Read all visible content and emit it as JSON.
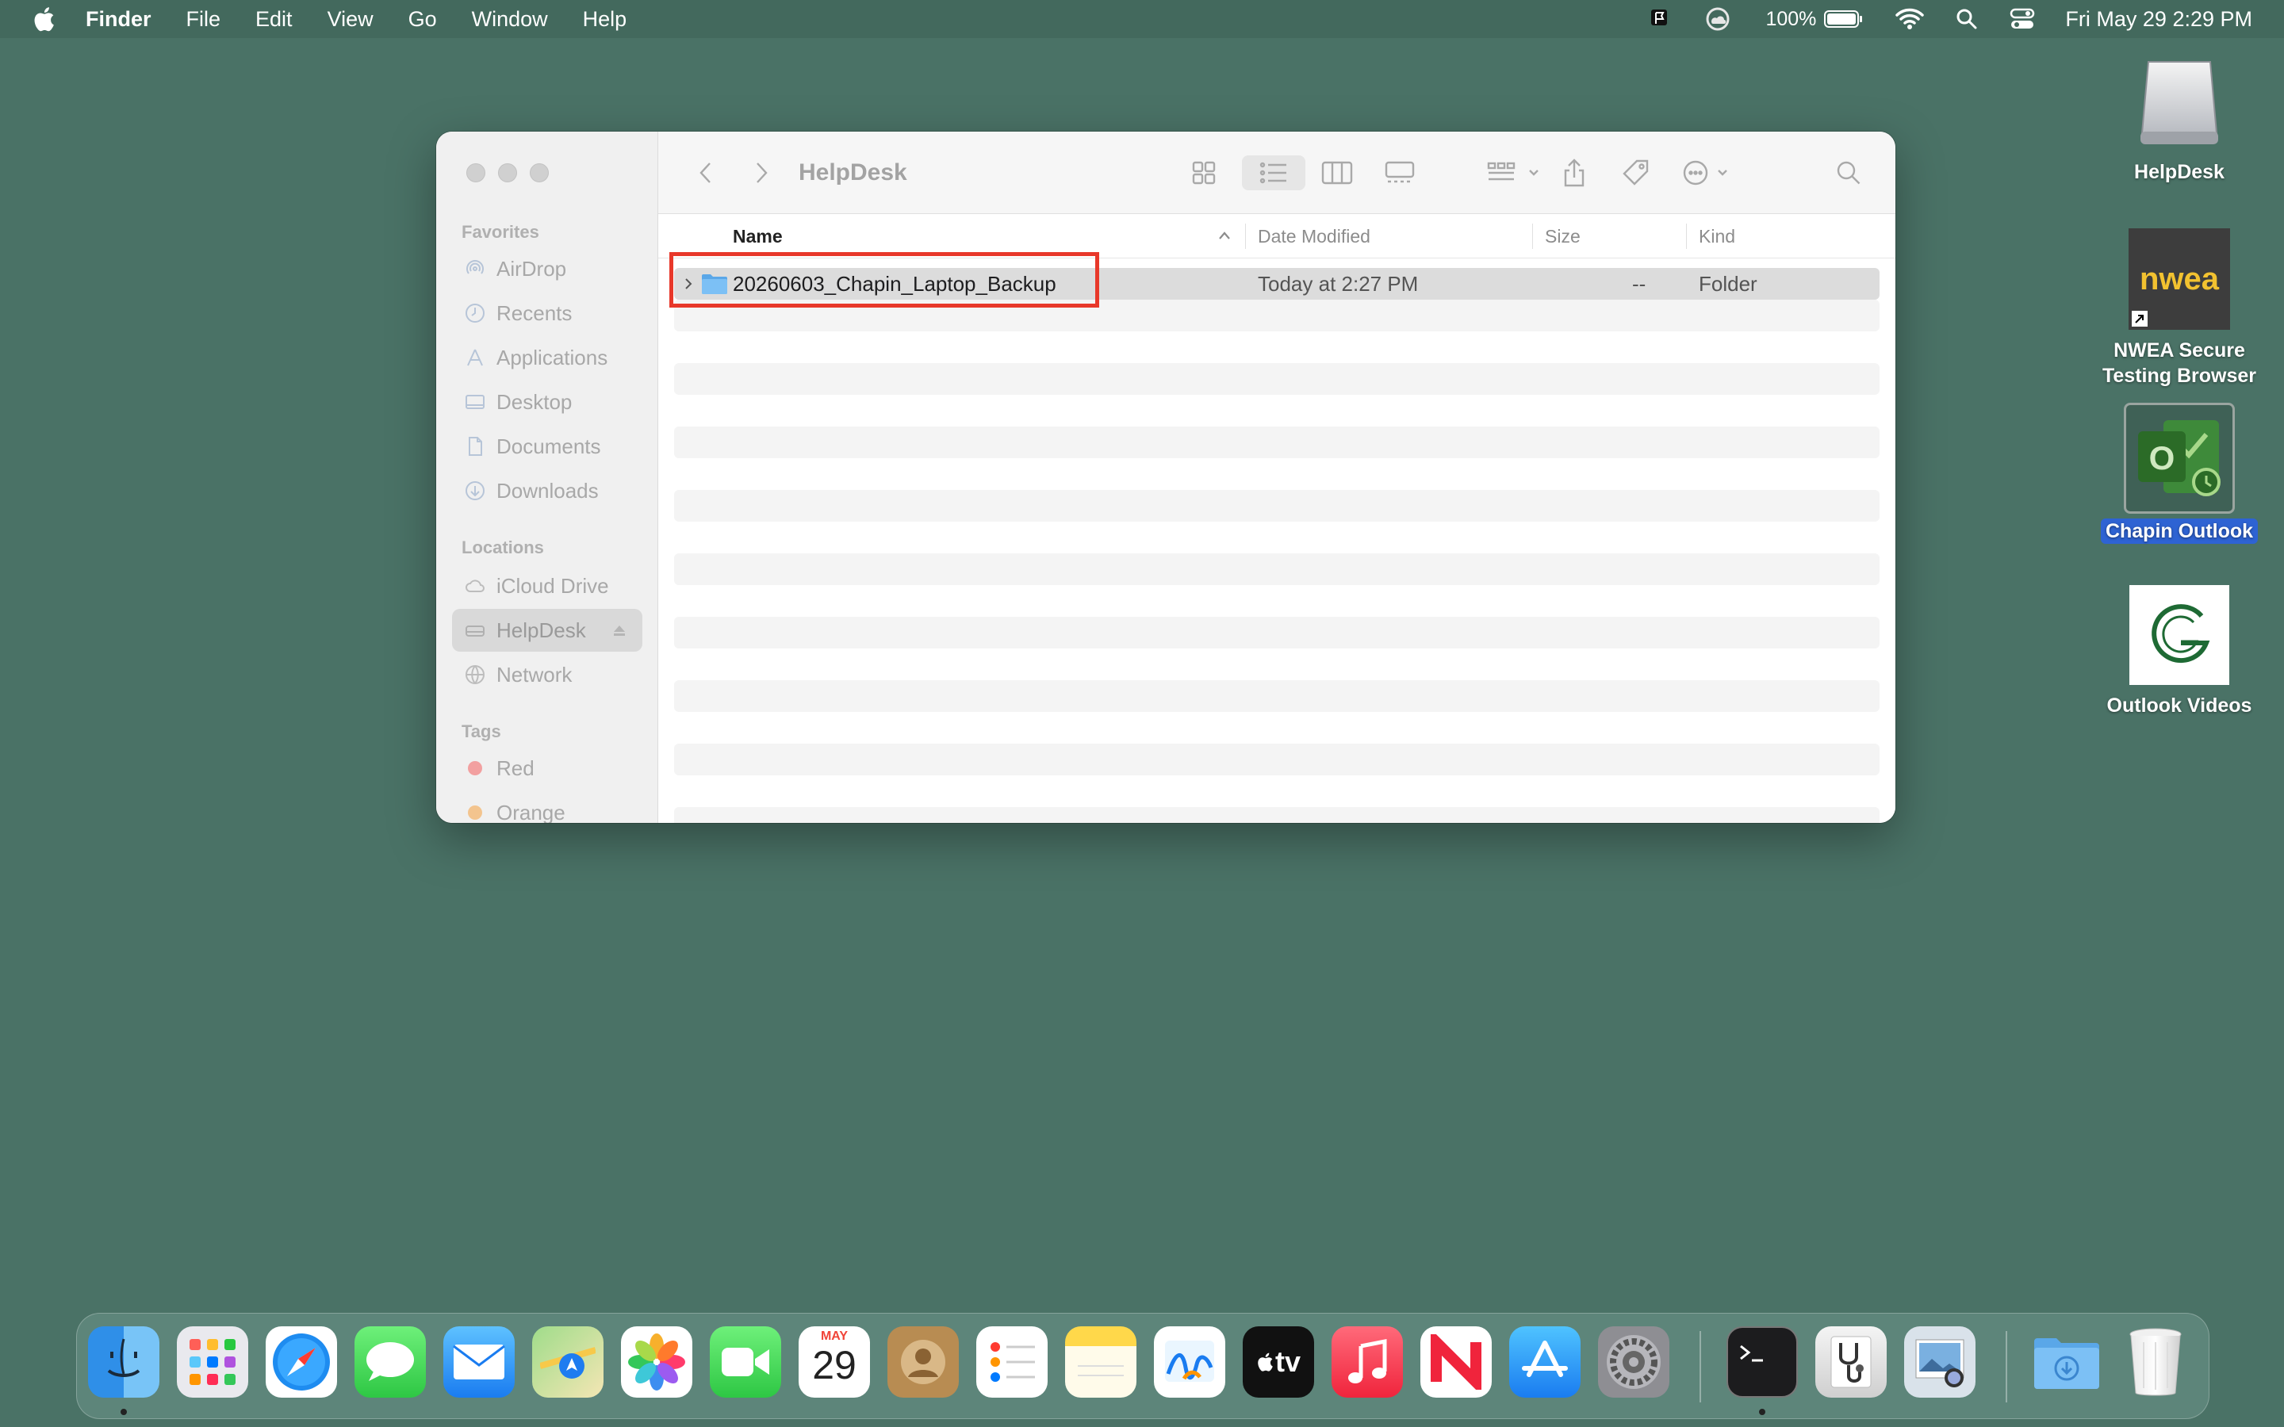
{
  "menubar": {
    "app_name": "Finder",
    "menus": [
      "File",
      "Edit",
      "View",
      "Go",
      "Window",
      "Help"
    ],
    "battery": "100%",
    "clock": "Fri May 29  2:29 PM"
  },
  "finder": {
    "title": "HelpDesk",
    "sidebar": {
      "favorites_header": "Favorites",
      "favorites": [
        "AirDrop",
        "Recents",
        "Applications",
        "Desktop",
        "Documents",
        "Downloads"
      ],
      "locations_header": "Locations",
      "locations": [
        "iCloud Drive",
        "HelpDesk",
        "Network"
      ],
      "tags_header": "Tags",
      "tags": [
        {
          "label": "Red",
          "color": "#f2a0a0"
        },
        {
          "label": "Orange",
          "color": "#f3c48e"
        }
      ]
    },
    "columns": {
      "name": "Name",
      "date": "Date Modified",
      "size": "Size",
      "kind": "Kind"
    },
    "rows": [
      {
        "name": "20260603_Chapin_Laptop_Backup",
        "date": "Today at 2:27 PM",
        "size": "--",
        "kind": "Folder"
      }
    ]
  },
  "desktop": {
    "icons": [
      {
        "label": "HelpDesk"
      },
      {
        "label_line1": "NWEA Secure",
        "label_line2": "Testing Browser",
        "badge": "nwea"
      },
      {
        "label": "Chapin Outlook"
      },
      {
        "label": "Outlook Videos"
      }
    ]
  },
  "dock": {
    "calendar_month": "MAY",
    "calendar_day": "29",
    "tv_label": "tv"
  },
  "colors": {
    "desktop": "#4a7266",
    "highlight": "#e8382a",
    "selection_blue": "#2e63d3"
  }
}
